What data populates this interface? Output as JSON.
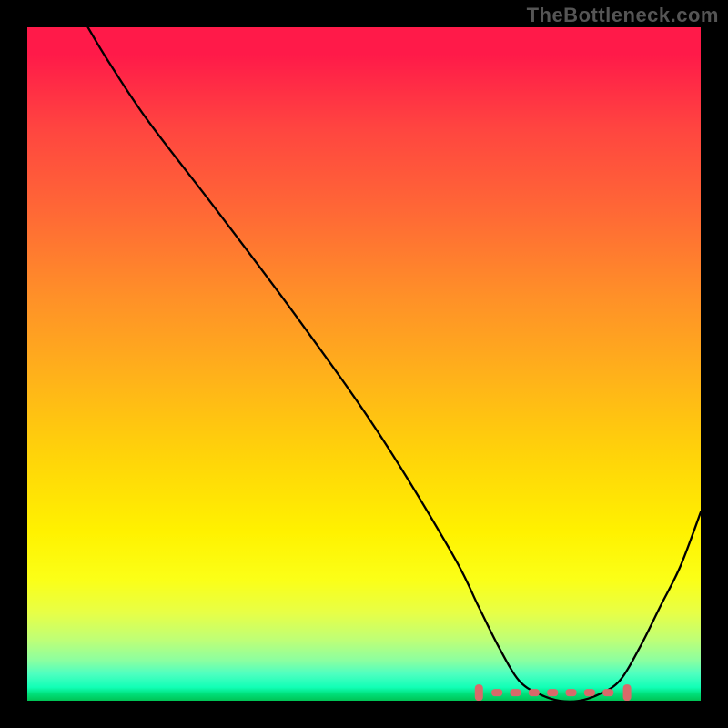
{
  "watermark": "TheBottleneck.com",
  "chart_data": {
    "type": "line",
    "title": "",
    "xlabel": "",
    "ylabel": "",
    "xlim": [
      0,
      100
    ],
    "ylim": [
      0,
      100
    ],
    "grid": false,
    "series": [
      {
        "name": "curve",
        "x": [
          9,
          12,
          18,
          28,
          40,
          52,
          63,
          67,
          70,
          73,
          76,
          79,
          82,
          85,
          88,
          91,
          94,
          97,
          100
        ],
        "y": [
          100,
          95,
          86,
          73,
          57,
          40,
          22,
          14,
          8,
          3,
          1,
          0,
          0,
          1,
          3,
          8,
          14,
          20,
          28
        ]
      }
    ],
    "highlight_range_x": [
      67,
      89
    ],
    "highlight_y": 1.2,
    "highlight_color": "#d86a6a"
  }
}
